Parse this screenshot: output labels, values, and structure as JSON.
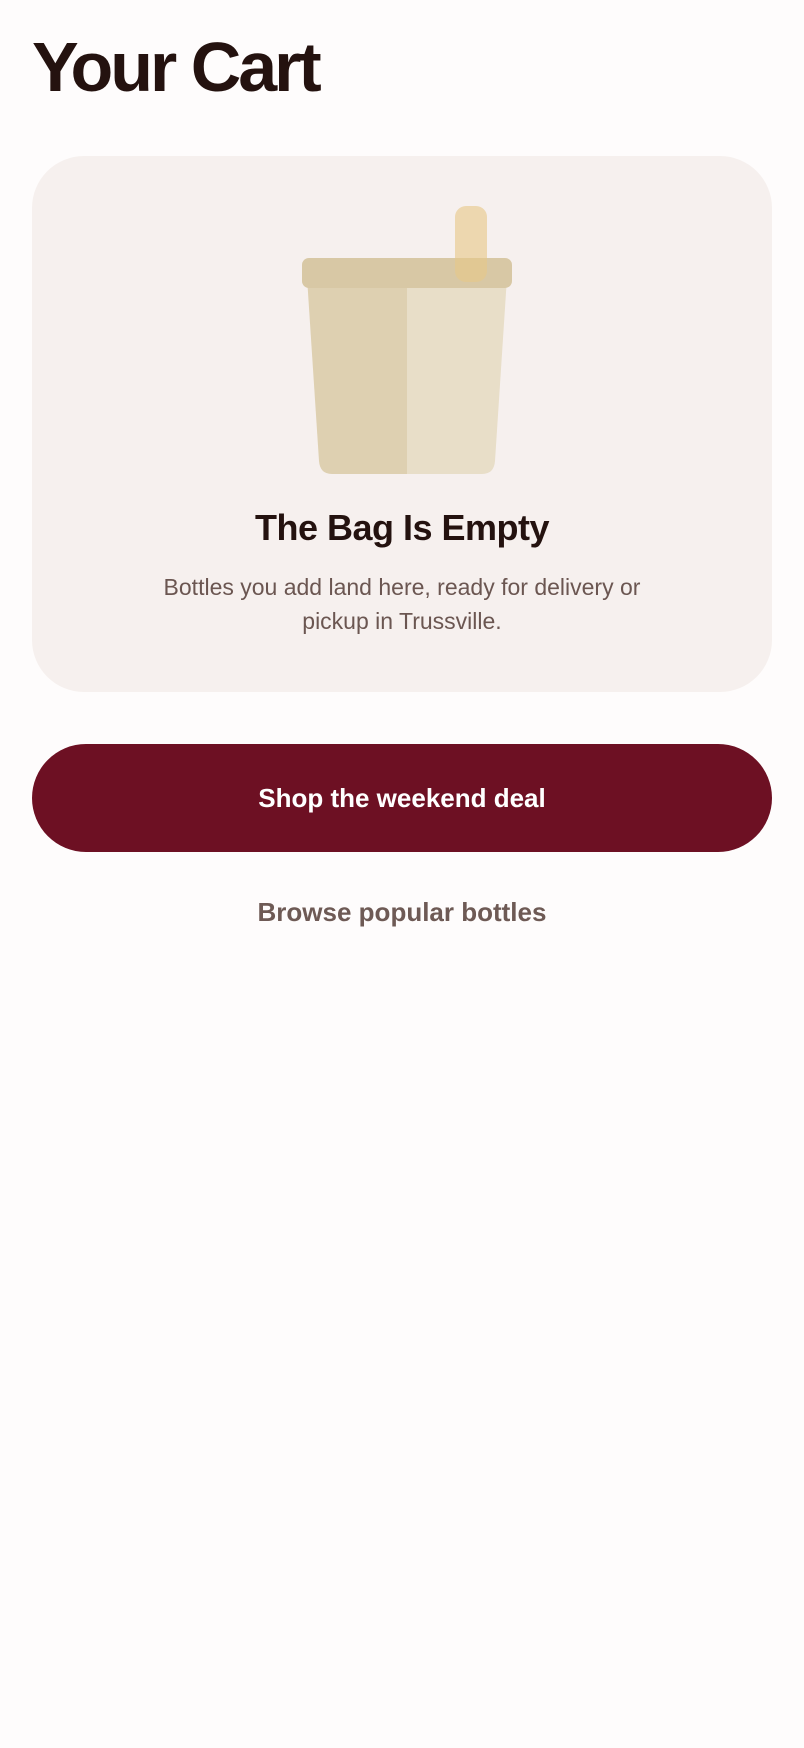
{
  "header": {
    "title": "Your Cart"
  },
  "empty_state": {
    "illustration": "shopping-bag-with-bottle-icon",
    "title": "The Bag Is Empty",
    "description": "Bottles you add land here, ready for delivery or pickup in Trussville."
  },
  "actions": {
    "primary_label": "Shop the weekend deal",
    "secondary_label": "Browse popular bottles"
  },
  "colors": {
    "brand_primary": "#6d1023",
    "title_text": "#24120f",
    "muted_text": "#6b5651",
    "card_background": "#f6f0ee",
    "page_background": "#fefcfc"
  }
}
